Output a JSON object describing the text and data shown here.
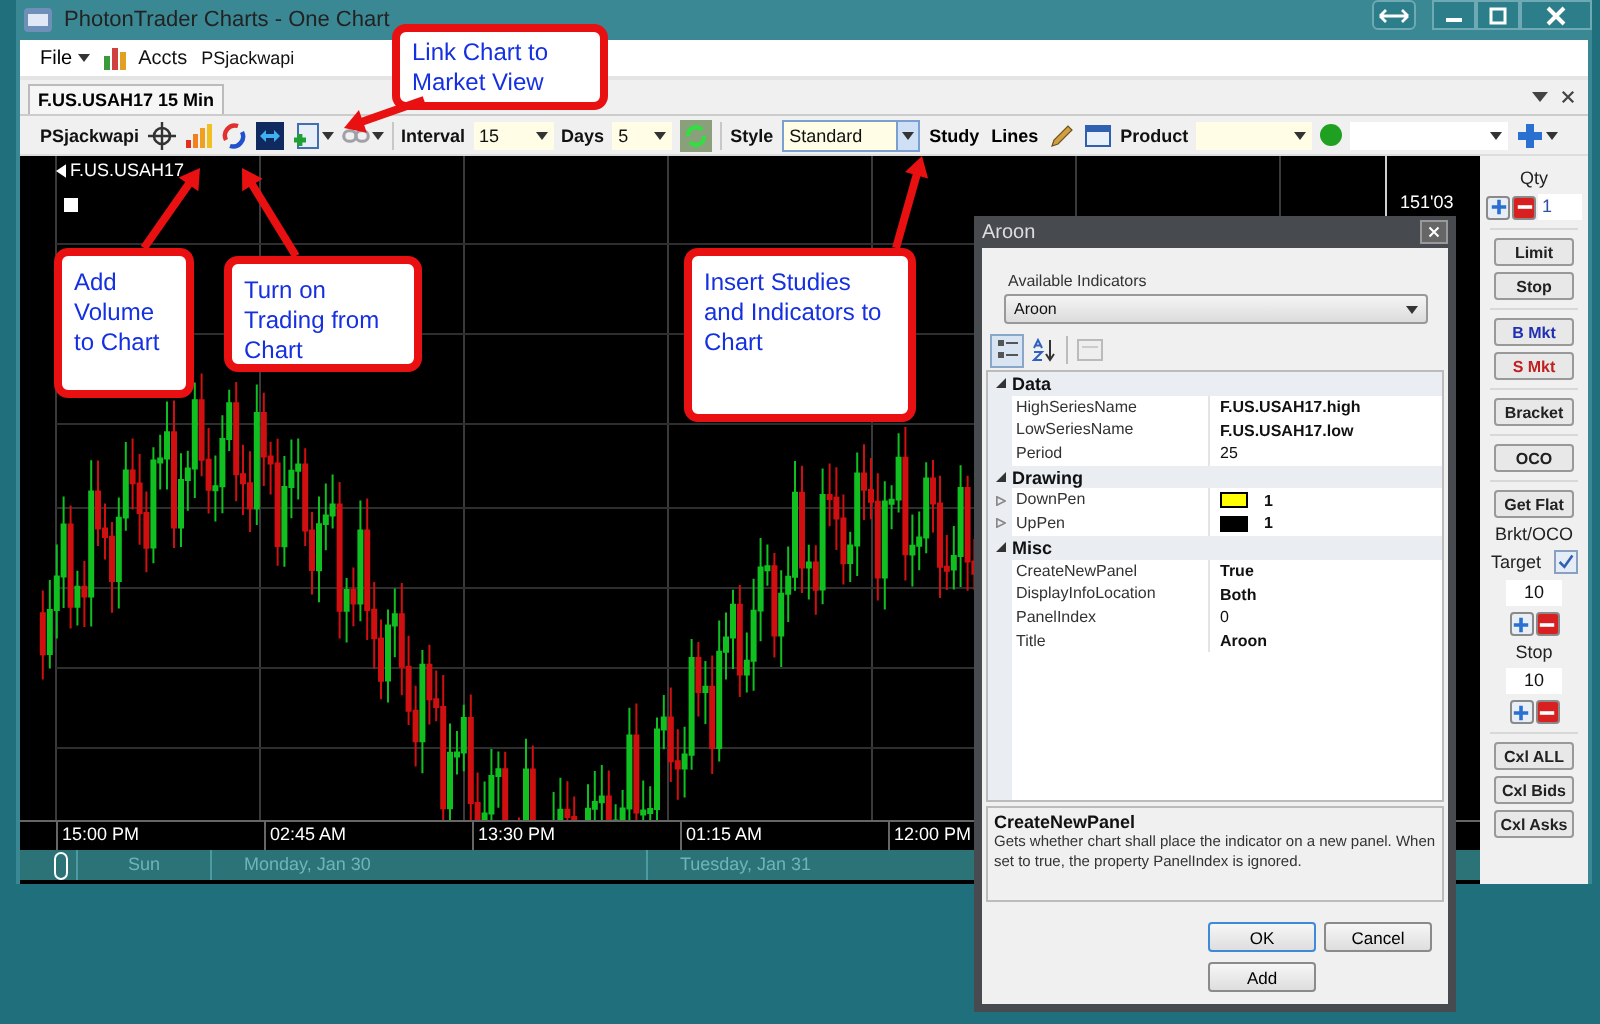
{
  "window": {
    "title": "PhotonTrader Charts - One Chart"
  },
  "menu": {
    "file": "File",
    "accounts_label": "Accts",
    "account": "PSjackwapi"
  },
  "chart_tabs": [
    {
      "label": "F.US.USAH17 15 Min",
      "selected": true
    }
  ],
  "toolbar": {
    "account": "PSjackwapi",
    "interval_label": "Interval",
    "interval": "15",
    "days_label": "Days",
    "days": "5",
    "style_label": "Style",
    "style": "Standard",
    "study": "Study",
    "lines": "Lines",
    "product_label": "Product",
    "connected": true
  },
  "chart": {
    "symbol": "F.US.USAH17",
    "price_label": "151'03",
    "time_labels": [
      "15:00 PM",
      "02:45 AM",
      "13:30 PM",
      "01:15 AM",
      "12:00 PM"
    ],
    "day_labels": [
      "Sun",
      "Monday, Jan 30",
      "Tuesday, Jan 31"
    ]
  },
  "order_panel": {
    "qty_label": "Qty",
    "qty": "1",
    "button_groups": [
      [
        {
          "label": "Limit",
          "kind": "normal"
        },
        {
          "label": "Stop",
          "kind": "normal"
        }
      ],
      [
        {
          "label": "B Mkt",
          "kind": "buy"
        },
        {
          "label": "S Mkt",
          "kind": "sell"
        }
      ],
      [
        {
          "label": "Bracket",
          "kind": "normal"
        }
      ],
      [
        {
          "label": "OCO",
          "kind": "normal"
        }
      ],
      [
        {
          "label": "Get Flat",
          "kind": "normal"
        }
      ]
    ],
    "bracket_label": "Brkt/OCO",
    "target": {
      "label": "Target",
      "checked": true,
      "value": "10"
    },
    "stop": {
      "label": "Stop",
      "value": "10"
    },
    "cancel_buttons": [
      {
        "label": "Cxl ALL",
        "kind": "normal"
      },
      {
        "label": "Cxl Bids",
        "kind": "normal"
      },
      {
        "label": "Cxl Asks",
        "kind": "normal"
      }
    ]
  },
  "dialog": {
    "title": "Aroon",
    "indicators_label": "Available Indicators",
    "indicator": "Aroon",
    "view_modes": [
      {
        "kind": "categorized",
        "selected": true
      },
      {
        "kind": "alphabetical",
        "selected": false
      }
    ],
    "categories": [
      {
        "name": "Data",
        "expanded": true,
        "properties": [
          {
            "kind": "text",
            "name": "HighSeriesName",
            "value": "F.US.USAH17.high",
            "modified": true
          },
          {
            "kind": "text",
            "name": "LowSeriesName",
            "value": "F.US.USAH17.low",
            "modified": true
          },
          {
            "kind": "text",
            "name": "Period",
            "value": "25",
            "modified": false
          }
        ]
      },
      {
        "name": "Drawing",
        "expanded": true,
        "properties": [
          {
            "kind": "pen",
            "name": "DownPen",
            "value": "1",
            "modified": true,
            "color": "#ffff00"
          },
          {
            "kind": "pen",
            "name": "UpPen",
            "value": "1",
            "modified": true,
            "color": "#000000"
          }
        ]
      },
      {
        "name": "Misc",
        "expanded": true,
        "properties": [
          {
            "kind": "text",
            "name": "CreateNewPanel",
            "value": "True",
            "modified": true
          },
          {
            "kind": "text",
            "name": "DisplayInfoLocation",
            "value": "Both",
            "modified": true
          },
          {
            "kind": "text",
            "name": "PanelIndex",
            "value": "0",
            "modified": false
          },
          {
            "kind": "text",
            "name": "Title",
            "value": "Aroon",
            "modified": true
          }
        ]
      }
    ],
    "description": {
      "title": "CreateNewPanel",
      "text": "Gets whether chart shall place the indicator on a new panel. When set to true, the property PanelIndex is ignored."
    },
    "buttons": [
      {
        "label": "OK",
        "default": true
      },
      {
        "label": "Cancel",
        "default": false
      },
      {
        "label": "Add",
        "default": false
      }
    ]
  },
  "callouts": [
    {
      "text": "Link Chart to Market View"
    },
    {
      "text": "Add Volume to Chart"
    },
    {
      "text": "Turn on Trading from Chart"
    },
    {
      "text": "Insert Studies and Indicators to Chart"
    }
  ]
}
